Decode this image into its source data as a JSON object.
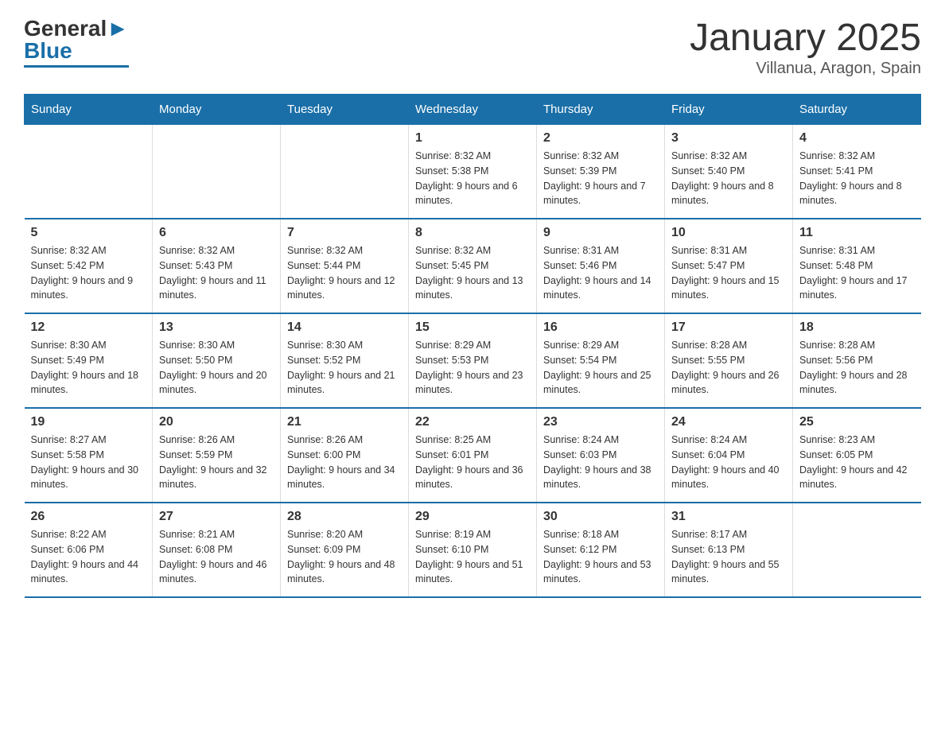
{
  "header": {
    "logo_general": "General",
    "logo_blue": "Blue",
    "month_title": "January 2025",
    "location": "Villanua, Aragon, Spain"
  },
  "days_of_week": [
    "Sunday",
    "Monday",
    "Tuesday",
    "Wednesday",
    "Thursday",
    "Friday",
    "Saturday"
  ],
  "weeks": [
    [
      {
        "day": "",
        "info": ""
      },
      {
        "day": "",
        "info": ""
      },
      {
        "day": "",
        "info": ""
      },
      {
        "day": "1",
        "info": "Sunrise: 8:32 AM\nSunset: 5:38 PM\nDaylight: 9 hours and 6 minutes."
      },
      {
        "day": "2",
        "info": "Sunrise: 8:32 AM\nSunset: 5:39 PM\nDaylight: 9 hours and 7 minutes."
      },
      {
        "day": "3",
        "info": "Sunrise: 8:32 AM\nSunset: 5:40 PM\nDaylight: 9 hours and 8 minutes."
      },
      {
        "day": "4",
        "info": "Sunrise: 8:32 AM\nSunset: 5:41 PM\nDaylight: 9 hours and 8 minutes."
      }
    ],
    [
      {
        "day": "5",
        "info": "Sunrise: 8:32 AM\nSunset: 5:42 PM\nDaylight: 9 hours and 9 minutes."
      },
      {
        "day": "6",
        "info": "Sunrise: 8:32 AM\nSunset: 5:43 PM\nDaylight: 9 hours and 11 minutes."
      },
      {
        "day": "7",
        "info": "Sunrise: 8:32 AM\nSunset: 5:44 PM\nDaylight: 9 hours and 12 minutes."
      },
      {
        "day": "8",
        "info": "Sunrise: 8:32 AM\nSunset: 5:45 PM\nDaylight: 9 hours and 13 minutes."
      },
      {
        "day": "9",
        "info": "Sunrise: 8:31 AM\nSunset: 5:46 PM\nDaylight: 9 hours and 14 minutes."
      },
      {
        "day": "10",
        "info": "Sunrise: 8:31 AM\nSunset: 5:47 PM\nDaylight: 9 hours and 15 minutes."
      },
      {
        "day": "11",
        "info": "Sunrise: 8:31 AM\nSunset: 5:48 PM\nDaylight: 9 hours and 17 minutes."
      }
    ],
    [
      {
        "day": "12",
        "info": "Sunrise: 8:30 AM\nSunset: 5:49 PM\nDaylight: 9 hours and 18 minutes."
      },
      {
        "day": "13",
        "info": "Sunrise: 8:30 AM\nSunset: 5:50 PM\nDaylight: 9 hours and 20 minutes."
      },
      {
        "day": "14",
        "info": "Sunrise: 8:30 AM\nSunset: 5:52 PM\nDaylight: 9 hours and 21 minutes."
      },
      {
        "day": "15",
        "info": "Sunrise: 8:29 AM\nSunset: 5:53 PM\nDaylight: 9 hours and 23 minutes."
      },
      {
        "day": "16",
        "info": "Sunrise: 8:29 AM\nSunset: 5:54 PM\nDaylight: 9 hours and 25 minutes."
      },
      {
        "day": "17",
        "info": "Sunrise: 8:28 AM\nSunset: 5:55 PM\nDaylight: 9 hours and 26 minutes."
      },
      {
        "day": "18",
        "info": "Sunrise: 8:28 AM\nSunset: 5:56 PM\nDaylight: 9 hours and 28 minutes."
      }
    ],
    [
      {
        "day": "19",
        "info": "Sunrise: 8:27 AM\nSunset: 5:58 PM\nDaylight: 9 hours and 30 minutes."
      },
      {
        "day": "20",
        "info": "Sunrise: 8:26 AM\nSunset: 5:59 PM\nDaylight: 9 hours and 32 minutes."
      },
      {
        "day": "21",
        "info": "Sunrise: 8:26 AM\nSunset: 6:00 PM\nDaylight: 9 hours and 34 minutes."
      },
      {
        "day": "22",
        "info": "Sunrise: 8:25 AM\nSunset: 6:01 PM\nDaylight: 9 hours and 36 minutes."
      },
      {
        "day": "23",
        "info": "Sunrise: 8:24 AM\nSunset: 6:03 PM\nDaylight: 9 hours and 38 minutes."
      },
      {
        "day": "24",
        "info": "Sunrise: 8:24 AM\nSunset: 6:04 PM\nDaylight: 9 hours and 40 minutes."
      },
      {
        "day": "25",
        "info": "Sunrise: 8:23 AM\nSunset: 6:05 PM\nDaylight: 9 hours and 42 minutes."
      }
    ],
    [
      {
        "day": "26",
        "info": "Sunrise: 8:22 AM\nSunset: 6:06 PM\nDaylight: 9 hours and 44 minutes."
      },
      {
        "day": "27",
        "info": "Sunrise: 8:21 AM\nSunset: 6:08 PM\nDaylight: 9 hours and 46 minutes."
      },
      {
        "day": "28",
        "info": "Sunrise: 8:20 AM\nSunset: 6:09 PM\nDaylight: 9 hours and 48 minutes."
      },
      {
        "day": "29",
        "info": "Sunrise: 8:19 AM\nSunset: 6:10 PM\nDaylight: 9 hours and 51 minutes."
      },
      {
        "day": "30",
        "info": "Sunrise: 8:18 AM\nSunset: 6:12 PM\nDaylight: 9 hours and 53 minutes."
      },
      {
        "day": "31",
        "info": "Sunrise: 8:17 AM\nSunset: 6:13 PM\nDaylight: 9 hours and 55 minutes."
      },
      {
        "day": "",
        "info": ""
      }
    ]
  ]
}
